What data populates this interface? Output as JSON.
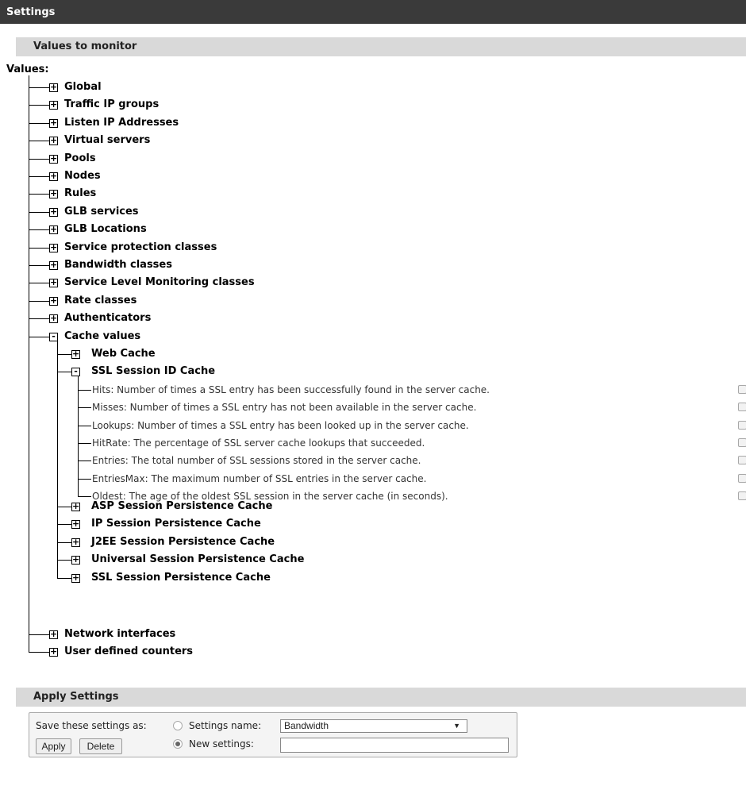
{
  "header": {
    "title": "Settings"
  },
  "sections": {
    "monitor_title": "Values to monitor",
    "apply_title": "Apply Settings"
  },
  "tree": {
    "root_label": "Values:",
    "top_items": [
      {
        "label": "Global",
        "state": "collapsed"
      },
      {
        "label": "Traffic IP groups",
        "state": "collapsed"
      },
      {
        "label": "Listen IP Addresses",
        "state": "collapsed"
      },
      {
        "label": "Virtual servers",
        "state": "collapsed"
      },
      {
        "label": "Pools",
        "state": "collapsed"
      },
      {
        "label": "Nodes",
        "state": "collapsed"
      },
      {
        "label": "Rules",
        "state": "collapsed"
      },
      {
        "label": "GLB services",
        "state": "collapsed"
      },
      {
        "label": "GLB Locations",
        "state": "collapsed"
      },
      {
        "label": "Service protection classes",
        "state": "collapsed"
      },
      {
        "label": "Bandwidth classes",
        "state": "collapsed"
      },
      {
        "label": "Service Level Monitoring classes",
        "state": "collapsed"
      },
      {
        "label": "Rate classes",
        "state": "collapsed"
      },
      {
        "label": "Authenticators",
        "state": "collapsed"
      },
      {
        "label": "Cache values",
        "state": "expanded"
      }
    ],
    "cache_children": [
      {
        "label": "Web Cache",
        "state": "collapsed"
      },
      {
        "label": "SSL Session ID Cache",
        "state": "expanded"
      },
      {
        "label": "ASP Session Persistence Cache",
        "state": "collapsed"
      },
      {
        "label": "IP Session Persistence Cache",
        "state": "collapsed"
      },
      {
        "label": "J2EE Session Persistence Cache",
        "state": "collapsed"
      },
      {
        "label": "Universal Session Persistence Cache",
        "state": "collapsed"
      },
      {
        "label": "SSL Session Persistence Cache",
        "state": "collapsed"
      }
    ],
    "ssl_leaves": [
      {
        "label": "Hits: Number of times a SSL entry has been successfully found in the server cache.",
        "checked": false
      },
      {
        "label": "Misses: Number of times a SSL entry has not been available in the server cache.",
        "checked": false
      },
      {
        "label": "Lookups: Number of times a SSL entry has been looked up in the server cache.",
        "checked": false
      },
      {
        "label": "HitRate: The percentage of SSL server cache lookups that succeeded.",
        "checked": false
      },
      {
        "label": "Entries: The total number of SSL sessions stored in the server cache.",
        "checked": false
      },
      {
        "label": "EntriesMax: The maximum number of SSL entries in the server cache.",
        "checked": false
      },
      {
        "label": "Oldest: The age of the oldest SSL session in the server cache (in seconds).",
        "checked": false
      }
    ],
    "bottom_items": [
      {
        "label": "Network interfaces",
        "state": "collapsed"
      },
      {
        "label": "User defined counters",
        "state": "collapsed"
      }
    ],
    "expand_glyph": "+",
    "collapse_glyph": "-"
  },
  "apply": {
    "save_as_label": "Save these settings as:",
    "settings_name_label": "Settings name:",
    "settings_name_selected": "Bandwidth",
    "settings_name_checked": false,
    "new_settings_label": "New settings:",
    "new_settings_checked": true,
    "new_settings_value": "",
    "apply_button": "Apply",
    "delete_button": "Delete"
  }
}
